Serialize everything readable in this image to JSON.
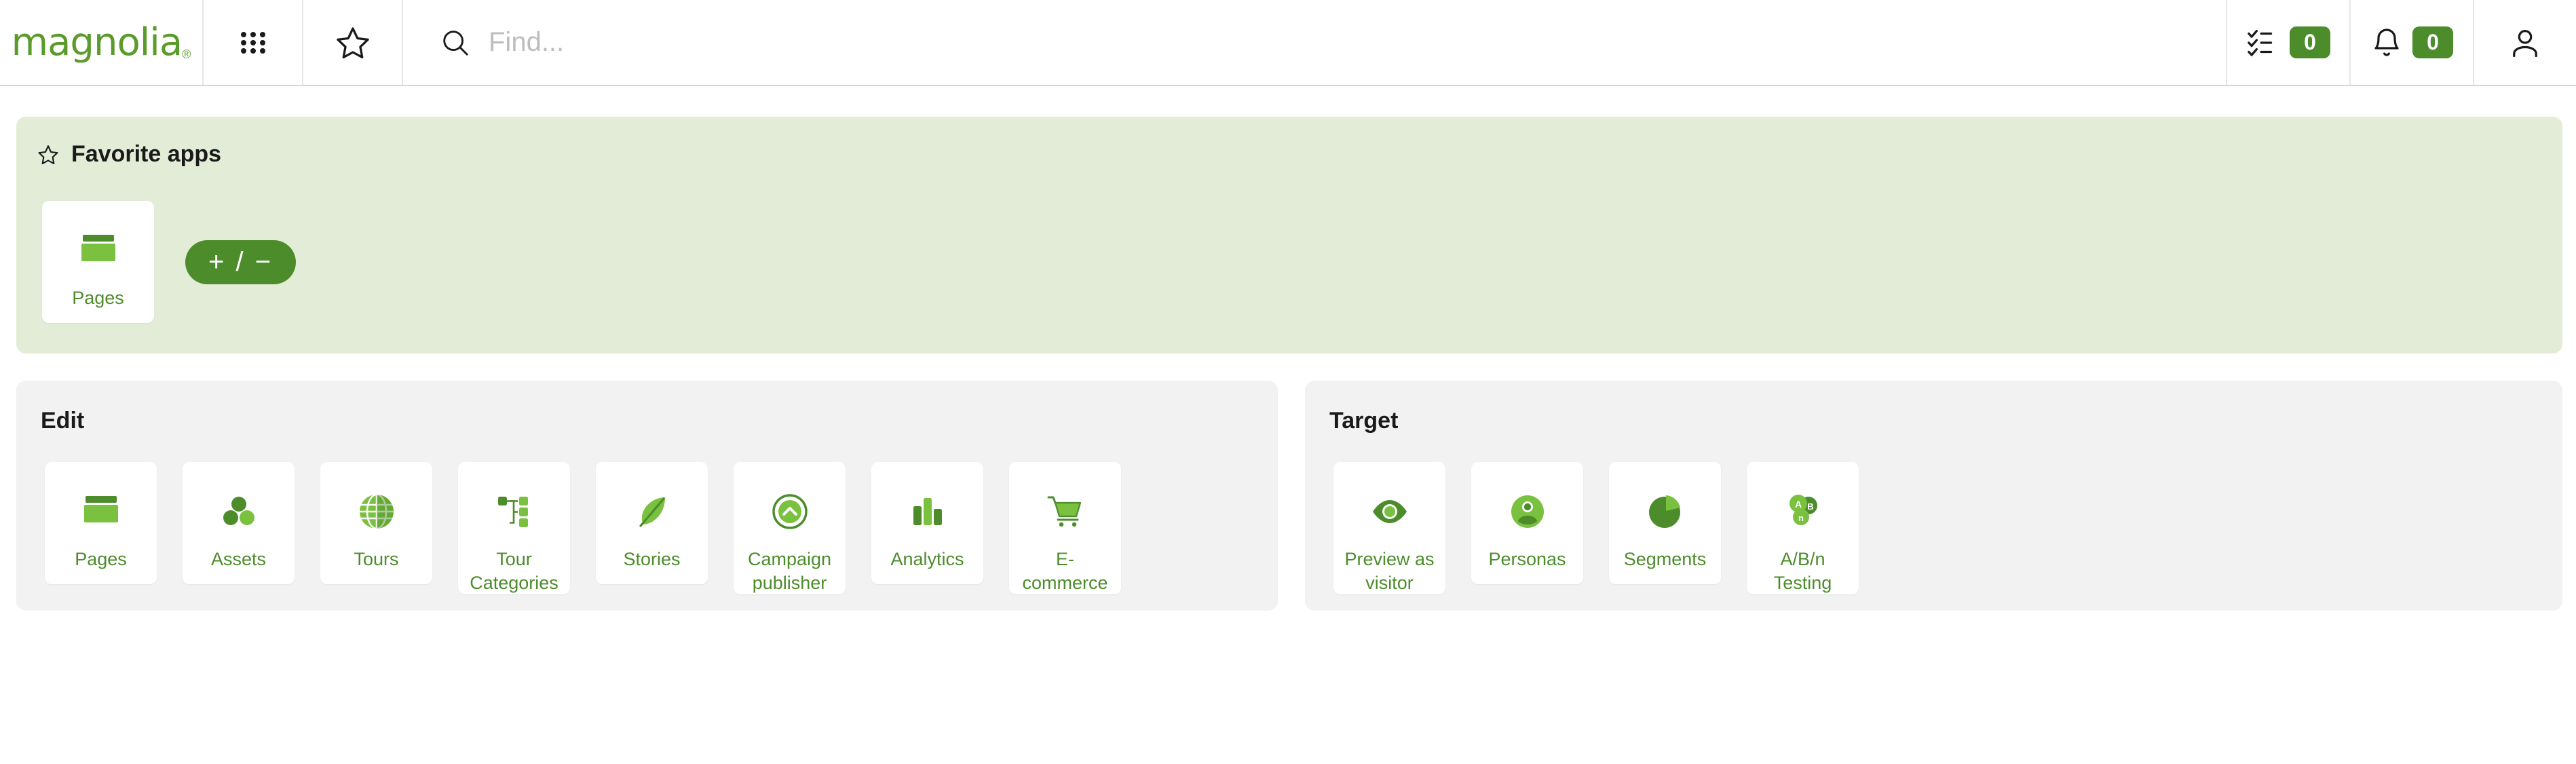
{
  "header": {
    "logo_text": "magnolia",
    "logo_registered": "®",
    "apps_grid_icon": "apps-grid-icon",
    "favorites_icon": "star-icon",
    "search": {
      "icon": "search-icon",
      "placeholder": "Find...",
      "value": ""
    },
    "tasks": {
      "icon": "tasks-checklist-icon",
      "badge": "0"
    },
    "notifications": {
      "icon": "bell-icon",
      "badge": "0"
    },
    "user": {
      "icon": "user-avatar-icon"
    }
  },
  "favorites": {
    "icon": "star-icon",
    "title": "Favorite apps",
    "edit_button_label": "+ / −",
    "apps": [
      {
        "label": "Pages",
        "icon": "pages-icon"
      }
    ]
  },
  "sections": [
    {
      "title": "Edit",
      "apps": [
        {
          "label": "Pages",
          "icon": "pages-icon"
        },
        {
          "label": "Assets",
          "icon": "assets-circles-icon"
        },
        {
          "label": "Tours",
          "icon": "globe-icon"
        },
        {
          "label": "Tour Categories",
          "icon": "tree-hierarchy-icon"
        },
        {
          "label": "Stories",
          "icon": "leaf-feather-icon"
        },
        {
          "label": "Campaign publisher",
          "icon": "circle-chevron-up-icon"
        },
        {
          "label": "Analytics",
          "icon": "bar-chart-icon"
        },
        {
          "label": "E-commerce",
          "icon": "shopping-cart-icon"
        }
      ]
    },
    {
      "title": "Target",
      "apps": [
        {
          "label": "Preview as visitor",
          "icon": "eye-icon"
        },
        {
          "label": "Personas",
          "icon": "person-circle-icon"
        },
        {
          "label": "Segments",
          "icon": "pie-chart-icon"
        },
        {
          "label": "A/B/n Testing",
          "icon": "abn-circles-icon"
        }
      ]
    }
  ],
  "colors": {
    "brand_green": "#5a9b2b",
    "dark_green": "#4c8c2b",
    "light_green": "#7ac13f",
    "favorites_bg": "#e3ecd7",
    "panel_bg": "#f2f2f2",
    "badge_green": "#4c8c2b"
  }
}
